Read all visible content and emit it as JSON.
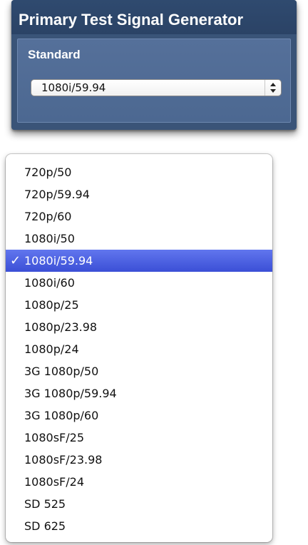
{
  "panel": {
    "title": "Primary Test Signal Generator",
    "label": "Standard",
    "selected_value": "1080i/59.94"
  },
  "menu": {
    "check_glyph": "✓",
    "selected_index": 4,
    "items": [
      {
        "label": "720p/50"
      },
      {
        "label": "720p/59.94"
      },
      {
        "label": "720p/60"
      },
      {
        "label": "1080i/50"
      },
      {
        "label": "1080i/59.94"
      },
      {
        "label": "1080i/60"
      },
      {
        "label": "1080p/25"
      },
      {
        "label": "1080p/23.98"
      },
      {
        "label": "1080p/24"
      },
      {
        "label": "3G 1080p/50"
      },
      {
        "label": "3G 1080p/59.94"
      },
      {
        "label": "3G 1080p/60"
      },
      {
        "label": "1080sF/25"
      },
      {
        "label": "1080sF/23.98"
      },
      {
        "label": "1080sF/24"
      },
      {
        "label": "SD 525"
      },
      {
        "label": "SD 625"
      }
    ]
  },
  "colors": {
    "panel_bg": "#3a5478",
    "panel_body_bg": "#4f6b93",
    "selection_bg": "#4a5fe3"
  }
}
